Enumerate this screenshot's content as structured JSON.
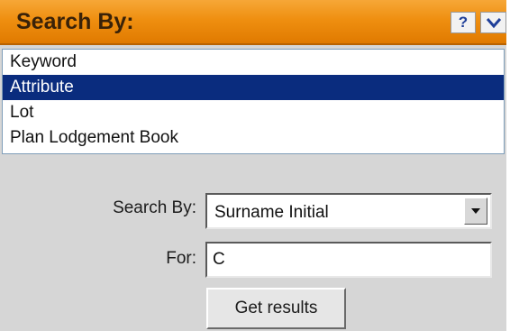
{
  "header": {
    "title": "Search By:",
    "help_label": "?",
    "collapse_icon": "chevron-down-icon"
  },
  "search_types": {
    "items": [
      "Keyword",
      "Attribute",
      "Lot",
      "Plan Lodgement Book"
    ],
    "selected": "Attribute"
  },
  "form": {
    "search_by_label": "Search By:",
    "search_by_value": "Surname Initial",
    "for_label": "For:",
    "for_value": "C",
    "submit_label": "Get results"
  },
  "colors": {
    "header_orange": "#ef8f10",
    "selection_blue": "#0a2c7e",
    "panel_gray": "#d6d6d6"
  }
}
